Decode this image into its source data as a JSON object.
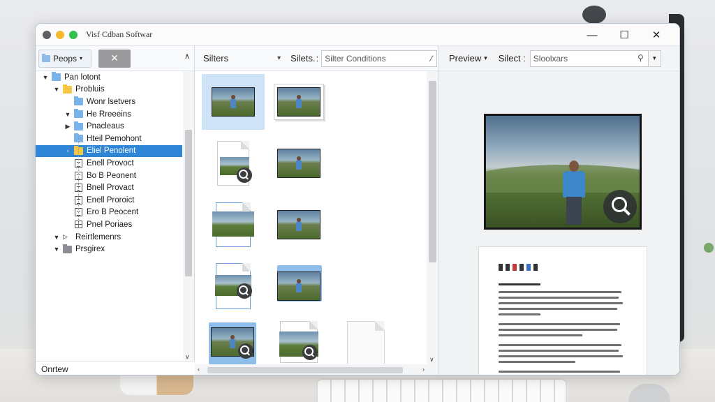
{
  "window": {
    "title": "Visf Cdban Softwar",
    "controls": {
      "minimize": "—",
      "maximize": "☐",
      "close": "✕"
    }
  },
  "left": {
    "dropdown_label": "Peops",
    "close_label": "✕",
    "tree": [
      {
        "label": "Pan lotont",
        "indent": 0,
        "twisty": "▼",
        "icon": "folder-b"
      },
      {
        "label": "Probluis",
        "indent": 1,
        "twisty": "▼",
        "icon": "folder-y"
      },
      {
        "label": "Wonr lsetvers",
        "indent": 2,
        "twisty": "",
        "icon": "folder-b"
      },
      {
        "label": "He Rreeeins",
        "indent": 2,
        "twisty": "▼",
        "icon": "folder-b"
      },
      {
        "label": "Pnacleaus",
        "indent": 2,
        "twisty": "▶",
        "icon": "folder-b"
      },
      {
        "label": "Hteil Pemohont",
        "indent": 2,
        "twisty": "",
        "icon": "folder-b"
      },
      {
        "label": "Eliel Penolent",
        "indent": 2,
        "twisty": "◦",
        "icon": "folder-y",
        "selected": true
      },
      {
        "label": "Enell Provoct",
        "indent": 2,
        "twisty": "",
        "icon": "doc"
      },
      {
        "label": "Bo B Peonent",
        "indent": 2,
        "twisty": "",
        "icon": "doc"
      },
      {
        "label": "Bnell Provact",
        "indent": 2,
        "twisty": "",
        "icon": "doc"
      },
      {
        "label": "Enell Proroict",
        "indent": 2,
        "twisty": "",
        "icon": "doc"
      },
      {
        "label": "Ero B Peocent",
        "indent": 2,
        "twisty": "",
        "icon": "doc"
      },
      {
        "label": "Pnel Poriaes",
        "indent": 2,
        "twisty": "",
        "icon": "grid"
      },
      {
        "label": "Reirtlemenrs",
        "indent": 1,
        "twisty": "▼",
        "icon": "arrow"
      },
      {
        "label": "Prsgirex",
        "indent": 1,
        "twisty": "▼",
        "icon": "folder-g"
      }
    ],
    "footer": "Onrtew"
  },
  "middle": {
    "filters_label": "Silters",
    "filter2_label": "Silets.",
    "conditions_placeholder": "Silter Conditions"
  },
  "right": {
    "preview_label": "Preview",
    "select_label": "Silect :",
    "search_value": "Sloolxars"
  },
  "colors": {
    "selection": "#2f86d6",
    "thumb_selection": "#cfe3f7",
    "folder_yellow": "#f6c744",
    "folder_blue": "#79b3ea"
  }
}
